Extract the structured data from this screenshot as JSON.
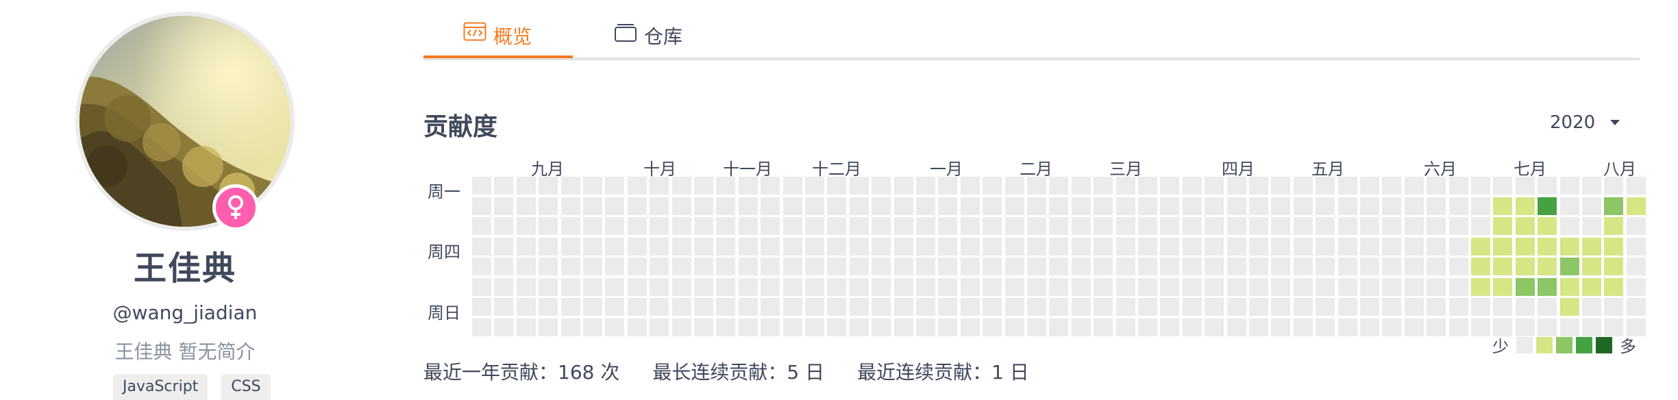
{
  "profile": {
    "name": "王佳典",
    "handle": "@wang_jiadian",
    "bio": "王佳典 暂无简介",
    "gender": "female",
    "tags": [
      "JavaScript",
      "CSS"
    ]
  },
  "tabs": [
    {
      "label": "概览",
      "icon": "code-window-icon",
      "active": true
    },
    {
      "label": "仓库",
      "icon": "repo-stack-icon",
      "active": false
    }
  ],
  "contribution": {
    "title": "贡献度",
    "year": "2020",
    "months": [
      "九月",
      "十月",
      "十一月",
      "十二月",
      "一月",
      "二月",
      "三月",
      "四月",
      "五月",
      "六月",
      "七月",
      "八月"
    ],
    "weekdays": [
      "周一",
      "周四",
      "周日"
    ],
    "legend": {
      "less": "少",
      "more": "多"
    },
    "colors": [
      "#ebebeb",
      "#d6e685",
      "#8cc665",
      "#44a340",
      "#1e6823"
    ],
    "levels": [
      [
        0,
        0,
        0,
        0,
        0,
        0,
        0,
        0,
        0,
        0,
        0,
        0,
        0,
        0,
        0,
        0,
        0,
        0,
        0,
        0,
        0,
        0,
        0,
        0,
        0,
        0,
        0,
        0,
        0,
        0,
        0,
        0,
        0,
        0,
        0,
        0,
        0,
        0,
        0,
        0,
        0,
        0,
        0,
        0,
        0,
        0,
        0,
        0,
        0,
        0,
        0,
        0,
        0
      ],
      [
        0,
        0,
        0,
        0,
        0,
        0,
        0,
        0,
        0,
        0,
        0,
        0,
        0,
        0,
        0,
        0,
        0,
        0,
        0,
        0,
        0,
        0,
        0,
        0,
        0,
        0,
        0,
        0,
        0,
        0,
        0,
        0,
        0,
        0,
        0,
        0,
        0,
        0,
        0,
        0,
        0,
        0,
        0,
        0,
        0,
        0,
        1,
        1,
        3,
        0,
        0,
        2,
        1
      ],
      [
        0,
        0,
        0,
        0,
        0,
        0,
        0,
        0,
        0,
        0,
        0,
        0,
        0,
        0,
        0,
        0,
        0,
        0,
        0,
        0,
        0,
        0,
        0,
        0,
        0,
        0,
        0,
        0,
        0,
        0,
        0,
        0,
        0,
        0,
        0,
        0,
        0,
        0,
        0,
        0,
        0,
        0,
        0,
        0,
        0,
        0,
        1,
        1,
        1,
        0,
        0,
        1,
        0
      ],
      [
        0,
        0,
        0,
        0,
        0,
        0,
        0,
        0,
        0,
        0,
        0,
        0,
        0,
        0,
        0,
        0,
        0,
        0,
        0,
        0,
        0,
        0,
        0,
        0,
        0,
        0,
        0,
        0,
        0,
        0,
        0,
        0,
        0,
        0,
        0,
        0,
        0,
        0,
        0,
        0,
        0,
        0,
        0,
        0,
        0,
        1,
        1,
        1,
        1,
        1,
        1,
        1,
        0
      ],
      [
        0,
        0,
        0,
        0,
        0,
        0,
        0,
        0,
        0,
        0,
        0,
        0,
        0,
        0,
        0,
        0,
        0,
        0,
        0,
        0,
        0,
        0,
        0,
        0,
        0,
        0,
        0,
        0,
        0,
        0,
        0,
        0,
        0,
        0,
        0,
        0,
        0,
        0,
        0,
        0,
        0,
        0,
        0,
        0,
        0,
        1,
        1,
        1,
        1,
        2,
        1,
        1,
        0
      ],
      [
        0,
        0,
        0,
        0,
        0,
        0,
        0,
        0,
        0,
        0,
        0,
        0,
        0,
        0,
        0,
        0,
        0,
        0,
        0,
        0,
        0,
        0,
        0,
        0,
        0,
        0,
        0,
        0,
        0,
        0,
        0,
        0,
        0,
        0,
        0,
        0,
        0,
        0,
        0,
        0,
        0,
        0,
        0,
        0,
        0,
        1,
        1,
        2,
        2,
        1,
        1,
        1,
        0
      ],
      [
        0,
        0,
        0,
        0,
        0,
        0,
        0,
        0,
        0,
        0,
        0,
        0,
        0,
        0,
        0,
        0,
        0,
        0,
        0,
        0,
        0,
        0,
        0,
        0,
        0,
        0,
        0,
        0,
        0,
        0,
        0,
        0,
        0,
        0,
        0,
        0,
        0,
        0,
        0,
        0,
        0,
        0,
        0,
        0,
        0,
        0,
        0,
        0,
        0,
        1,
        0,
        0,
        0
      ],
      [
        0,
        0,
        0,
        0,
        0,
        0,
        0,
        0,
        0,
        0,
        0,
        0,
        0,
        0,
        0,
        0,
        0,
        0,
        0,
        0,
        0,
        0,
        0,
        0,
        0,
        0,
        0,
        0,
        0,
        0,
        0,
        0,
        0,
        0,
        0,
        0,
        0,
        0,
        0,
        0,
        0,
        0,
        0,
        0,
        0,
        0,
        0,
        0,
        0,
        0,
        0,
        0,
        0
      ]
    ],
    "stats": {
      "year_total": "最近一年贡献：168 次",
      "longest_streak": "最长连续贡献：5 日",
      "current_streak": "最近连续贡献：1 日"
    }
  }
}
